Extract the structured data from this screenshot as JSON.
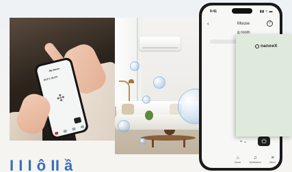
{
  "small_phone": {
    "title": "My Room",
    "temp": "25.0°c 35.5%",
    "fan_icon": "fan-icon",
    "power_icon": "power-icon"
  },
  "big_phone": {
    "time": "9:41",
    "signal": "▮▮ ≈ ▬",
    "house_label": "Mouse",
    "room_label": "g room",
    "help_label": "?",
    "back_label": "‹",
    "fan_label": "an",
    "chevron_label": "≈ ⌄",
    "power_label": "⏻",
    "tabs": [
      {
        "icon": "⌂",
        "label": "Home"
      },
      {
        "icon": "♫",
        "label": "Notification"
      },
      {
        "icon": "≡",
        "label": "Menu"
      }
    ]
  },
  "nanoe_card": {
    "brand": "nanoeX"
  },
  "heading": {
    "text": "I   I I ộ   II ầ"
  },
  "colors": {
    "heading_blue": "#2f6fbf",
    "card_green": "#dfe9dc"
  }
}
